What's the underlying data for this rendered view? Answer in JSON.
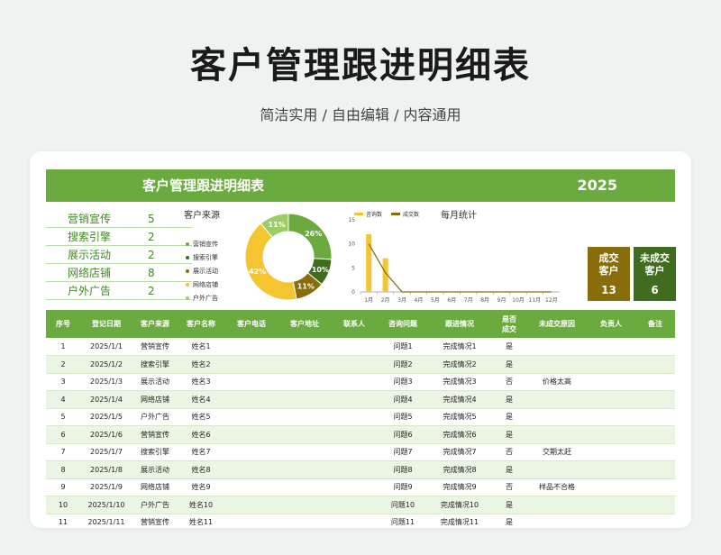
{
  "page": {
    "title": "客户管理跟进明细表",
    "subtitle": "简洁实用 / 自由编辑 / 内容通用"
  },
  "sheet": {
    "title": "客户管理跟进明细表",
    "year": "2025"
  },
  "sources": [
    {
      "name": "营销宣传",
      "count": "5"
    },
    {
      "name": "搜索引擎",
      "count": "2"
    },
    {
      "name": "展示活动",
      "count": "2"
    },
    {
      "name": "网络店铺",
      "count": "8"
    },
    {
      "name": "户外广告",
      "count": "2"
    }
  ],
  "pie_chart_title": "客户来源",
  "line_chart_title": "每月统计",
  "kpi": {
    "deal_label_1": "成交",
    "deal_label_2": "客户",
    "deal_value": "13",
    "nodeal_label_1": "未成交",
    "nodeal_label_2": "客户",
    "nodeal_value": "6"
  },
  "colors": {
    "green": "#6aaa3f",
    "dark_green": "#3f6c1f",
    "yellow": "#f5c431",
    "brown": "#8a6d0b"
  },
  "chart_data": [
    {
      "type": "pie",
      "title": "客户来源",
      "donut": true,
      "slices": [
        {
          "label": "营销宣传",
          "value": 26,
          "display": "26%",
          "color": "#6aaa3f"
        },
        {
          "label": "搜索引擎",
          "value": 10,
          "display": "10%",
          "color": "#3f6c1f"
        },
        {
          "label": "展示活动",
          "value": 11,
          "display": "11%",
          "color": "#8a6d0b"
        },
        {
          "label": "网络店铺",
          "value": 42,
          "display": "42%",
          "color": "#f5c431"
        },
        {
          "label": "户外广告",
          "value": 11,
          "display": "11%",
          "color": "#9ccc65"
        }
      ],
      "legend_placement": "left"
    },
    {
      "type": "line",
      "title": "每月统计",
      "categories": [
        "1月",
        "2月",
        "3月",
        "4月",
        "5月",
        "6月",
        "7月",
        "8月",
        "9月",
        "10月",
        "11月",
        "12月"
      ],
      "series": [
        {
          "name": "咨询数",
          "kind": "bar",
          "color": "#f5c431",
          "values": [
            12,
            7,
            0,
            0,
            0,
            0,
            0,
            0,
            0,
            0,
            0,
            0
          ]
        },
        {
          "name": "成交数",
          "kind": "line",
          "color": "#8a6d0b",
          "values": [
            10,
            4,
            0,
            0,
            0,
            0,
            0,
            0,
            0,
            0,
            0,
            0
          ]
        }
      ],
      "ylim": [
        0,
        15
      ],
      "yticks": [
        "0",
        "5",
        "10",
        "15"
      ],
      "grid": false,
      "legend_placement": "top-left"
    }
  ],
  "table": {
    "headers": [
      [
        "序号"
      ],
      [
        "登记日期"
      ],
      [
        "客户来源"
      ],
      [
        "客户名称"
      ],
      [
        "客户电话"
      ],
      [
        "客户地址"
      ],
      [
        "联系人"
      ],
      [
        "咨询问题"
      ],
      [
        "跟进情况"
      ],
      [
        "是否",
        "成交"
      ],
      [
        "未成交原因"
      ],
      [
        "负责人"
      ],
      [
        "备注"
      ]
    ],
    "rows": [
      [
        "1",
        "2025/1/1",
        "营销宣传",
        "姓名1",
        "",
        "",
        "",
        "问题1",
        "完成情况1",
        "是",
        "",
        "",
        ""
      ],
      [
        "2",
        "2025/1/2",
        "搜索引擎",
        "姓名2",
        "",
        "",
        "",
        "问题2",
        "完成情况2",
        "是",
        "",
        "",
        ""
      ],
      [
        "3",
        "2025/1/3",
        "展示活动",
        "姓名3",
        "",
        "",
        "",
        "问题3",
        "完成情况3",
        "否",
        "价格太高",
        "",
        ""
      ],
      [
        "4",
        "2025/1/4",
        "网络店铺",
        "姓名4",
        "",
        "",
        "",
        "问题4",
        "完成情况4",
        "是",
        "",
        "",
        ""
      ],
      [
        "5",
        "2025/1/5",
        "户外广告",
        "姓名5",
        "",
        "",
        "",
        "问题5",
        "完成情况5",
        "是",
        "",
        "",
        ""
      ],
      [
        "6",
        "2025/1/6",
        "营销宣传",
        "姓名6",
        "",
        "",
        "",
        "问题6",
        "完成情况6",
        "是",
        "",
        "",
        ""
      ],
      [
        "7",
        "2025/1/7",
        "搜索引擎",
        "姓名7",
        "",
        "",
        "",
        "问题7",
        "完成情况7",
        "否",
        "交期太赶",
        "",
        ""
      ],
      [
        "8",
        "2025/1/8",
        "展示活动",
        "姓名8",
        "",
        "",
        "",
        "问题8",
        "完成情况8",
        "是",
        "",
        "",
        ""
      ],
      [
        "9",
        "2025/1/9",
        "网络店铺",
        "姓名9",
        "",
        "",
        "",
        "问题9",
        "完成情况9",
        "否",
        "样品不合格",
        "",
        ""
      ],
      [
        "10",
        "2025/1/10",
        "户外广告",
        "姓名10",
        "",
        "",
        "",
        "问题10",
        "完成情况10",
        "是",
        "",
        "",
        ""
      ],
      [
        "11",
        "2025/1/11",
        "营销宣传",
        "姓名11",
        "",
        "",
        "",
        "问题11",
        "完成情况11",
        "是",
        "",
        "",
        ""
      ]
    ]
  }
}
